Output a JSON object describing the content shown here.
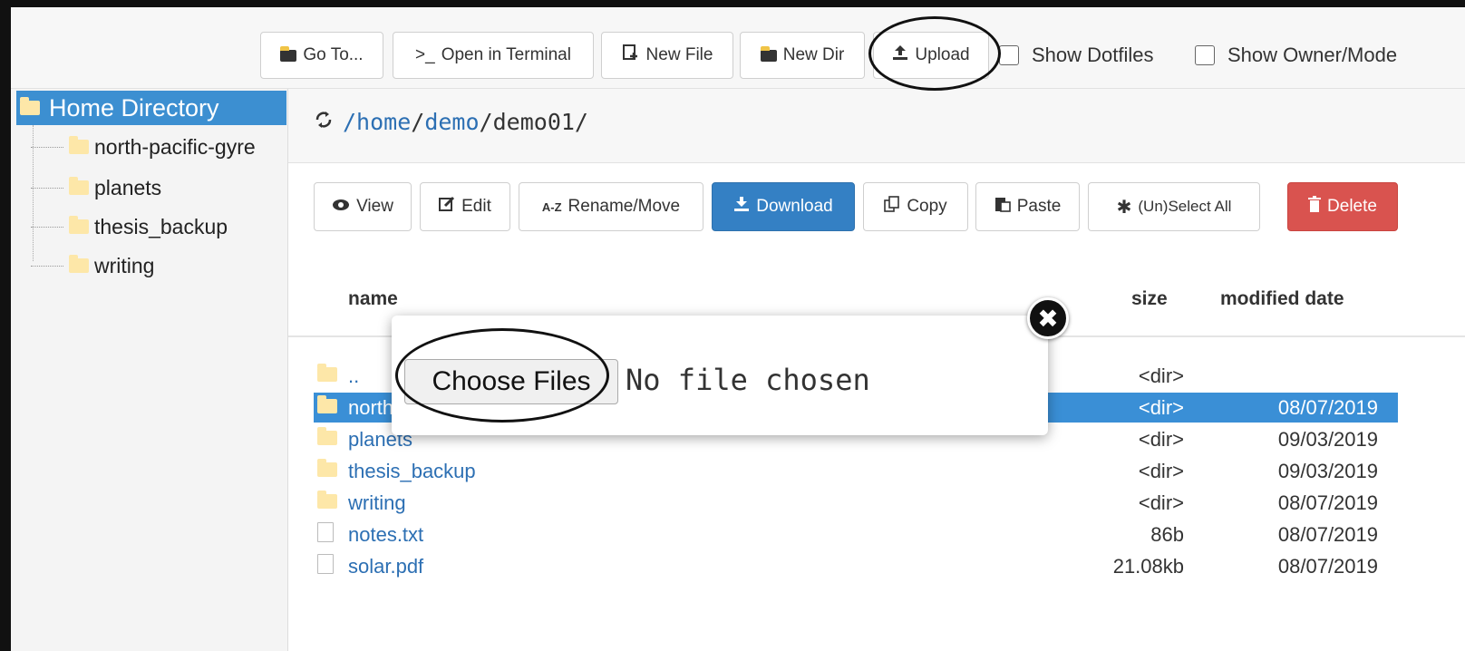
{
  "toolbar": {
    "goto": "Go To...",
    "terminal": "Open in Terminal",
    "terminal_prefix": ">_",
    "newfile": "New File",
    "newdir": "New Dir",
    "upload": "Upload",
    "show_dotfiles": "Show Dotfiles",
    "show_owner": "Show Owner/Mode"
  },
  "sidebar": {
    "home": "Home Directory",
    "items": [
      {
        "label": "north-pacific-gyre"
      },
      {
        "label": "planets"
      },
      {
        "label": "thesis_backup"
      },
      {
        "label": "writing"
      }
    ]
  },
  "path": {
    "refresh_icon": "refresh-icon",
    "seg1": "/home",
    "sep1": "/",
    "seg2": "demo",
    "sep2": "/",
    "seg3": "demo01",
    "sep3": "/"
  },
  "actions": {
    "view": "View",
    "edit": "Edit",
    "rename": "Rename/Move",
    "rename_prefix": "A-Z",
    "download": "Download",
    "copy": "Copy",
    "paste": "Paste",
    "select_all": "(Un)Select All",
    "delete": "Delete"
  },
  "table": {
    "headers": {
      "name": "name",
      "size": "size",
      "date": "modified date"
    },
    "rows": [
      {
        "name": "..",
        "size": "<dir>",
        "date": ""
      },
      {
        "name": "north-pacific-gyre",
        "size": "<dir>",
        "date": "08/07/2019"
      },
      {
        "name": "planets",
        "size": "<dir>",
        "date": "09/03/2019"
      },
      {
        "name": "thesis_backup",
        "size": "<dir>",
        "date": "09/03/2019"
      },
      {
        "name": "writing",
        "size": "<dir>",
        "date": "08/07/2019"
      },
      {
        "name": "notes.txt",
        "size": "86b",
        "date": "08/07/2019"
      },
      {
        "name": "solar.pdf",
        "size": "21.08kb",
        "date": "08/07/2019"
      }
    ]
  },
  "upload_dialog": {
    "choose": "Choose Files",
    "status": "No file chosen",
    "close": "✖"
  },
  "colors": {
    "accent": "#3480c4",
    "selected_row": "#3a8fd6",
    "delete": "#d9534f",
    "sidebar_home": "#3c8fd1"
  }
}
